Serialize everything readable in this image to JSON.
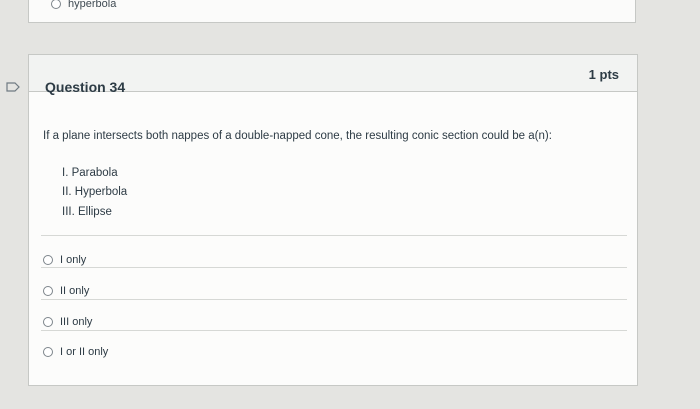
{
  "previous_question": {
    "option_label": "hyperbola"
  },
  "question": {
    "title": "Question 34",
    "points": "1 pts",
    "text": "If a plane intersects both nappes of a double-napped cone, the resulting conic section could be a(n):",
    "statements": [
      "I. Parabola",
      "II. Hyperbola",
      "III. Ellipse"
    ],
    "answers": [
      "I only",
      "II only",
      "III only",
      "I or II only"
    ]
  },
  "icons": {
    "flag": "flag-icon",
    "radio": "radio-button-icon"
  }
}
